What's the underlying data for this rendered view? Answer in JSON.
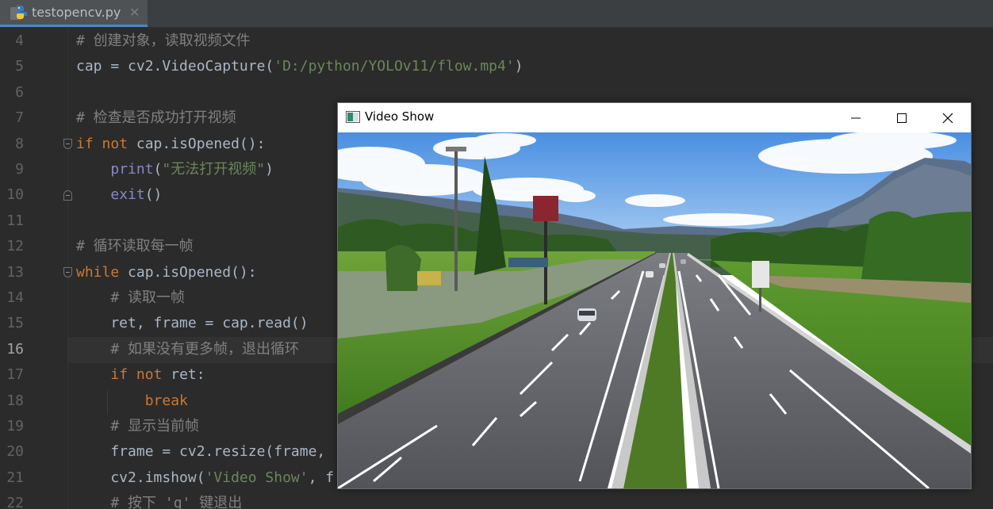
{
  "tab": {
    "filename": "testopencv.py",
    "close_glyph": "✕",
    "icon": "python-file-icon"
  },
  "editor": {
    "current_line": "16",
    "lines": [
      {
        "n": "4",
        "text": "# 创建对象，读取视频文件"
      },
      {
        "n": "5",
        "text": "cap = cv2.VideoCapture('D:/python/YOLOv11/flow.mp4')"
      },
      {
        "n": "6",
        "text": ""
      },
      {
        "n": "7",
        "text": "# 检查是否成功打开视频"
      },
      {
        "n": "8",
        "text": "if not cap.isOpened():"
      },
      {
        "n": "9",
        "text": "    print(\"无法打开视频\")"
      },
      {
        "n": "10",
        "text": "    exit()"
      },
      {
        "n": "11",
        "text": ""
      },
      {
        "n": "12",
        "text": "# 循环读取每一帧"
      },
      {
        "n": "13",
        "text": "while cap.isOpened():"
      },
      {
        "n": "14",
        "text": "    # 读取一帧"
      },
      {
        "n": "15",
        "text": "    ret, frame = cap.read()"
      },
      {
        "n": "16",
        "text": "    # 如果没有更多帧，退出循环"
      },
      {
        "n": "17",
        "text": "    if not ret:"
      },
      {
        "n": "18",
        "text": "        break"
      },
      {
        "n": "19",
        "text": "    # 显示当前帧"
      },
      {
        "n": "20",
        "text": "    frame = cv2.resize(frame,"
      },
      {
        "n": "21",
        "text": "    cv2.imshow('Video Show', f"
      },
      {
        "n": "22",
        "text": "    # 按下 'q' 键退出"
      }
    ]
  },
  "video_window": {
    "title": "Video Show",
    "icon": "opencv-window-icon",
    "buttons": [
      "minimize-icon",
      "maximize-icon",
      "close-icon"
    ]
  },
  "colors": {
    "editor_bg": "#2b2b2b",
    "comment": "#808080",
    "keyword": "#cc7832",
    "string": "#6a8759",
    "builtin": "#8888c6",
    "text": "#a9b7c6",
    "accent": "#4a88c7"
  }
}
